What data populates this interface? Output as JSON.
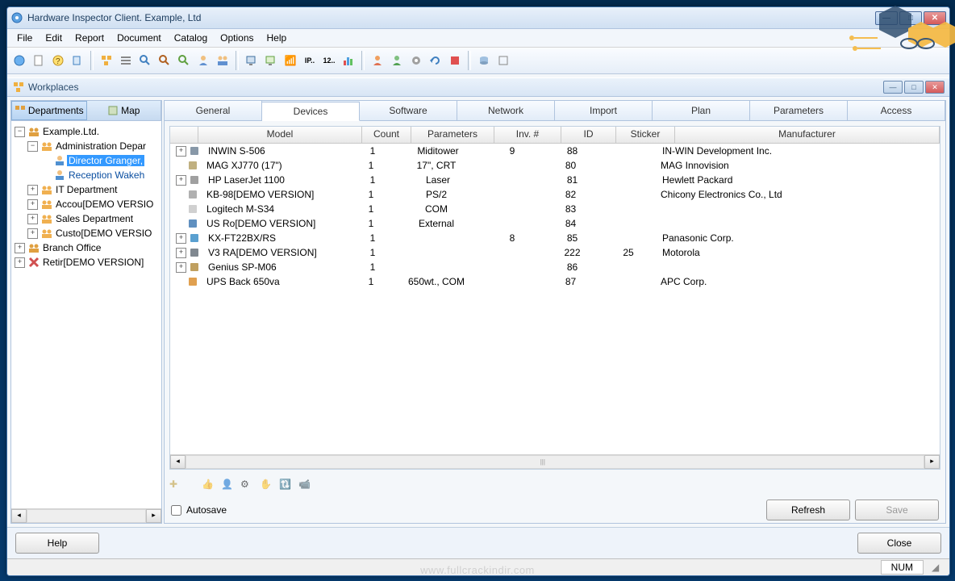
{
  "window": {
    "title": "Hardware Inspector Client. Example, Ltd"
  },
  "menu": [
    "File",
    "Edit",
    "Report",
    "Document",
    "Catalog",
    "Options",
    "Help"
  ],
  "sub": {
    "title": "Workplaces"
  },
  "leftTabs": {
    "departments": "Departments",
    "map": "Map"
  },
  "tree": [
    {
      "indent": 0,
      "exp": "-",
      "icon": "org",
      "label": "Example.Ltd."
    },
    {
      "indent": 1,
      "exp": "-",
      "icon": "grp",
      "label": "Administration Depar"
    },
    {
      "indent": 2,
      "exp": "",
      "icon": "usr",
      "label": "Director Granger,",
      "sel": true
    },
    {
      "indent": 2,
      "exp": "",
      "icon": "usr",
      "label": "Reception Wakeh",
      "link": true
    },
    {
      "indent": 1,
      "exp": "+",
      "icon": "grp",
      "label": "IT Department"
    },
    {
      "indent": 1,
      "exp": "+",
      "icon": "grp",
      "label": "Accou[DEMO VERSIO"
    },
    {
      "indent": 1,
      "exp": "+",
      "icon": "grp",
      "label": "Sales Department"
    },
    {
      "indent": 1,
      "exp": "+",
      "icon": "grp",
      "label": "Custo[DEMO VERSIO"
    },
    {
      "indent": 0,
      "exp": "+",
      "icon": "org",
      "label": "Branch Office"
    },
    {
      "indent": 0,
      "exp": "+",
      "icon": "del",
      "label": "Retir[DEMO VERSION]"
    }
  ],
  "tabs": [
    "General",
    "Devices",
    "Software",
    "Network",
    "Import",
    "Plan",
    "Parameters",
    "Access"
  ],
  "activeTab": "Devices",
  "columns": [
    "Model",
    "Count",
    "Parameters",
    "Inv. #",
    "ID",
    "Sticker",
    "Manufacturer"
  ],
  "rows": [
    {
      "exp": "+",
      "icon": "case",
      "model": "INWIN S-506",
      "count": "1",
      "param": "Miditower",
      "inv": "9",
      "id": "88",
      "stick": "",
      "manuf": "IN-WIN Development Inc."
    },
    {
      "exp": "",
      "icon": "crt",
      "model": "MAG XJ770 (17\")",
      "count": "1",
      "param": "17\", CRT",
      "inv": "",
      "id": "80",
      "stick": "",
      "manuf": "MAG Innovision"
    },
    {
      "exp": "+",
      "icon": "prn",
      "model": "HP LaserJet 1100",
      "count": "1",
      "param": "Laser",
      "inv": "",
      "id": "81",
      "stick": "",
      "manuf": "Hewlett Packard"
    },
    {
      "exp": "",
      "icon": "kbd",
      "model": "KB-98[DEMO VERSION]",
      "count": "1",
      "param": "PS/2",
      "inv": "",
      "id": "82",
      "stick": "",
      "manuf": "Chicony Electronics Co., Ltd"
    },
    {
      "exp": "",
      "icon": "mse",
      "model": "Logitech M-S34",
      "count": "1",
      "param": "COM",
      "inv": "",
      "id": "83",
      "stick": "",
      "manuf": ""
    },
    {
      "exp": "",
      "icon": "mdm",
      "model": "US Ro[DEMO VERSION]",
      "count": "1",
      "param": "External",
      "inv": "",
      "id": "84",
      "stick": "",
      "manuf": ""
    },
    {
      "exp": "+",
      "icon": "fax",
      "model": "KX-FT22BX/RS",
      "count": "1",
      "param": "",
      "inv": "8",
      "id": "85",
      "stick": "",
      "manuf": "Panasonic Corp."
    },
    {
      "exp": "+",
      "icon": "phn",
      "model": "V3 RA[DEMO VERSION]",
      "count": "1",
      "param": "",
      "inv": "",
      "id": "222",
      "stick": "25",
      "manuf": "Motorola"
    },
    {
      "exp": "+",
      "icon": "spk",
      "model": "Genius SP-M06",
      "count": "1",
      "param": "",
      "inv": "",
      "id": "86",
      "stick": "",
      "manuf": ""
    },
    {
      "exp": "",
      "icon": "ups",
      "model": "UPS Back 650va",
      "count": "1",
      "param": "650wt., COM",
      "inv": "",
      "id": "87",
      "stick": "",
      "manuf": "APC Corp."
    }
  ],
  "autosave": "Autosave",
  "buttons": {
    "refresh": "Refresh",
    "save": "Save",
    "help": "Help",
    "close": "Close"
  },
  "status": {
    "num": "NUM"
  },
  "watermark": "www.fullcrackindir.com"
}
